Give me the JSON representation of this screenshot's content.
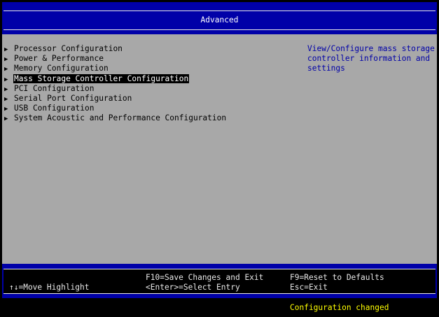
{
  "header": {
    "title": "Advanced"
  },
  "menu": {
    "items": [
      {
        "label": "Processor Configuration"
      },
      {
        "label": "Power & Performance"
      },
      {
        "label": "Memory Configuration"
      },
      {
        "label": "Mass Storage Controller Configuration"
      },
      {
        "label": "PCI Configuration"
      },
      {
        "label": "Serial Port Configuration"
      },
      {
        "label": "USB Configuration"
      },
      {
        "label": "System Acoustic and Performance Configuration"
      }
    ],
    "selected_index": 3,
    "arrow_icon": "triangle-right-icon"
  },
  "help": {
    "lines": [
      "View/Configure mass storage",
      "controller information and",
      "settings"
    ]
  },
  "footer": {
    "move_highlight": "↑↓=Move Highlight",
    "save_exit": "F10=Save Changes and Exit",
    "select_entry": "<Enter>=Select Entry",
    "reset_defaults": "F9=Reset to Defaults",
    "exit": "Esc=Exit"
  },
  "status": {
    "text": "Configuration changed"
  },
  "colors": {
    "header_bg": "#0000a8",
    "main_bg": "#a8a8a8",
    "help_text": "#0000a8",
    "status_text": "#ffff00"
  }
}
